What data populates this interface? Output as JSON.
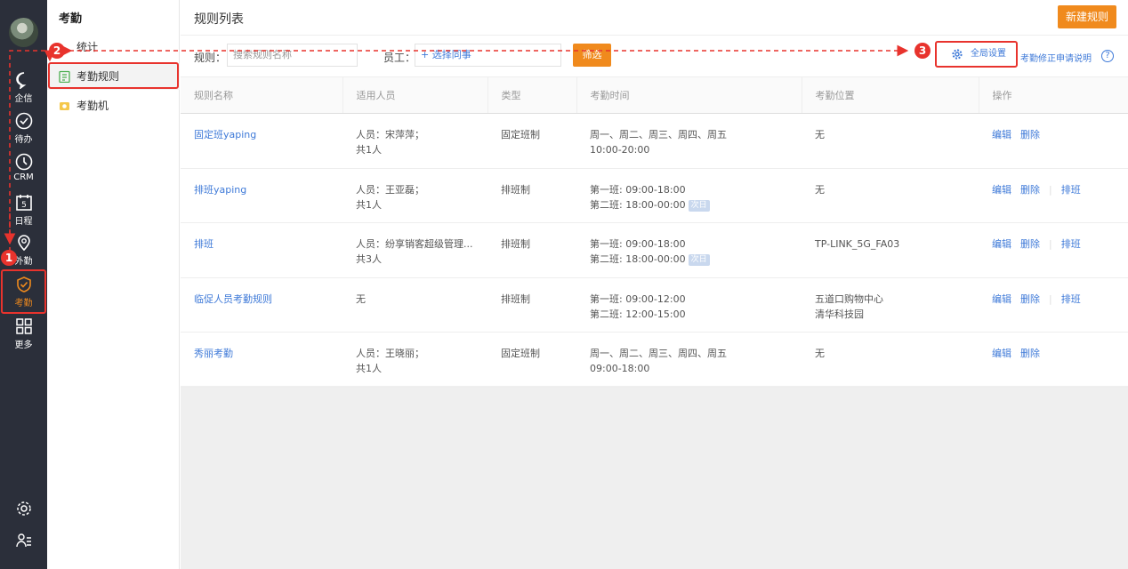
{
  "rail": {
    "items": [
      {
        "label": "企信",
        "icon": "chat-bubble-icon"
      },
      {
        "label": "待办",
        "icon": "check-circle-icon"
      },
      {
        "label": "CRM",
        "icon": "clock-icon"
      },
      {
        "label": "日程",
        "icon": "calendar-icon",
        "calendar_day": "5"
      },
      {
        "label": "外勤",
        "icon": "location-pin-icon"
      },
      {
        "label": "考勤",
        "icon": "attendance-icon",
        "active": true
      },
      {
        "label": "更多",
        "icon": "grid-icon"
      }
    ],
    "bottom": [
      {
        "icon": "settings-icon"
      },
      {
        "icon": "user-list-icon"
      }
    ]
  },
  "sidebar": {
    "title": "考勤",
    "items": [
      {
        "label": "统计"
      },
      {
        "label": "考勤规则"
      },
      {
        "label": "考勤机"
      }
    ]
  },
  "header": {
    "title": "规则列表",
    "new_button": "新建规则"
  },
  "filters": {
    "rule_label": "规则：",
    "rule_placeholder": "搜索规则名称",
    "staff_label": "员工：",
    "staff_link": "+ 选择同事",
    "filter_button": "筛选",
    "global_settings": "全局设置",
    "note_link": "考勤修正申请说明",
    "help": "?"
  },
  "table": {
    "columns": [
      "规则名称",
      "适用人员",
      "类型",
      "考勤时间",
      "考勤位置",
      "操作"
    ],
    "rows": [
      {
        "name": "固定班yaping",
        "staff": [
          "人员：宋萍萍；",
          "共1人"
        ],
        "type": "固定班制",
        "time": [
          "周一、周二、周三、周四、周五",
          "10:00-20:00"
        ],
        "time_tag": "",
        "location": [
          "无"
        ],
        "ops": [
          "编辑",
          "删除"
        ]
      },
      {
        "name": "排班yaping",
        "staff": [
          "人员：王亚磊；",
          "共1人"
        ],
        "type": "排班制",
        "time": [
          "第一班: 09:00-18:00",
          "第二班: 18:00-00:00"
        ],
        "time_tag": "次日",
        "location": [
          "无"
        ],
        "ops": [
          "编辑",
          "删除",
          "排班"
        ]
      },
      {
        "name": "排班",
        "staff": [
          "人员：纷享销客超级管理...",
          "共3人"
        ],
        "type": "排班制",
        "time": [
          "第一班: 09:00-18:00",
          "第二班: 18:00-00:00"
        ],
        "time_tag": "次日",
        "location": [
          "TP-LINK_5G_FA03"
        ],
        "ops": [
          "编辑",
          "删除",
          "排班"
        ]
      },
      {
        "name": "临促人员考勤规则",
        "staff": [
          "无",
          ""
        ],
        "type": "排班制",
        "time": [
          "第一班: 09:00-12:00",
          "第二班: 12:00-15:00"
        ],
        "time_tag": "",
        "location": [
          "五道口购物中心",
          "清华科技园"
        ],
        "ops": [
          "编辑",
          "删除",
          "排班"
        ]
      },
      {
        "name": "秀丽考勤",
        "staff": [
          "人员：王晓丽；",
          "共1人"
        ],
        "type": "固定班制",
        "time": [
          "周一、周二、周三、周四、周五",
          "09:00-18:00"
        ],
        "time_tag": "",
        "location": [
          "无"
        ],
        "ops": [
          "编辑",
          "删除"
        ]
      }
    ]
  },
  "annotations": {
    "marker_1": "1",
    "marker_2": "2",
    "marker_3": "3",
    "color": "#e8332d"
  },
  "colors": {
    "accent": "#f08a1d",
    "link": "#3f7ad8",
    "rail_bg": "#2b2f3a"
  }
}
